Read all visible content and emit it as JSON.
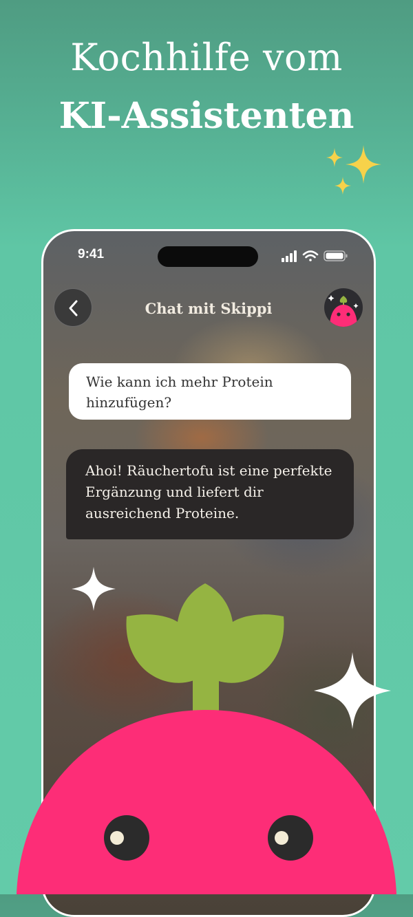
{
  "headline": {
    "line1": "Kochhilfe vom",
    "line2": "KI-Assistenten"
  },
  "status_bar": {
    "time": "9:41"
  },
  "chat": {
    "title": "Chat mit Skippi",
    "messages": [
      {
        "role": "user",
        "text": "Wie kann ich mehr Protein hinzufügen?"
      },
      {
        "role": "assistant",
        "text": "Ahoi! Räuchertofu ist eine perfekte Ergänzung und liefert dir ausreichend Proteine."
      }
    ]
  },
  "icons": {
    "back": "chevron-left-icon",
    "avatar": "radish-mascot-icon",
    "signal": "cellular-signal-icon",
    "wifi": "wifi-icon",
    "battery": "battery-icon",
    "sparkle": "sparkle-icon"
  },
  "colors": {
    "background": "#5fc6a5",
    "mascot_body": "#fd2d77",
    "mascot_leaf": "#95b442",
    "user_bubble": "#ffffff",
    "assistant_bubble": "#2a2727",
    "sparkle_gold": "#f7d24a"
  }
}
